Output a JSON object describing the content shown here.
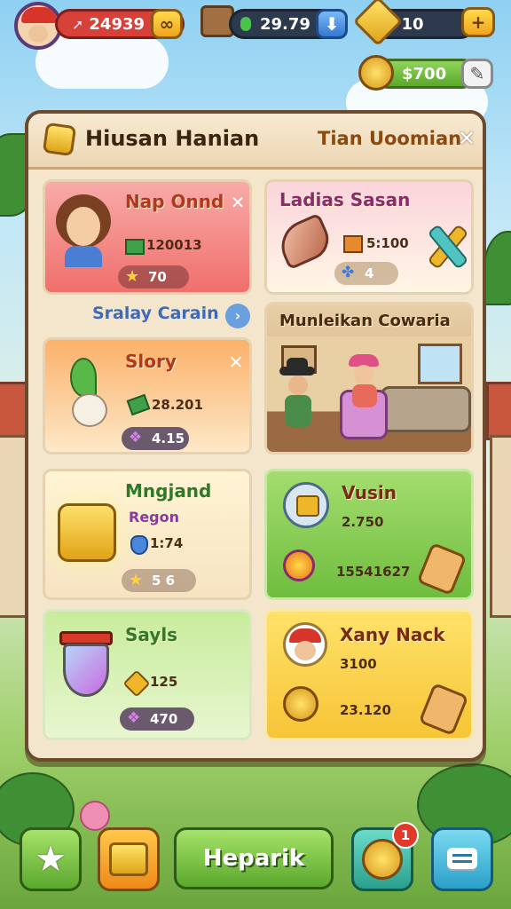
{
  "topbar": {
    "level_value": "24939",
    "cash_value": "29.79",
    "gem_value": "10",
    "coin_value": "$700"
  },
  "panel": {
    "title": "Hiusan Hanian",
    "subtitle": "Tian Uoomian"
  },
  "cards": {
    "c1": {
      "title": "Nap Onnd",
      "stat1": "120013",
      "badge": "70"
    },
    "c2": {
      "title": "Ladias Sasan",
      "stat1": "5:100",
      "badge": "4"
    },
    "section_link": "Sralay Carain",
    "c3": {
      "title": "Slory",
      "stat1": "28.201",
      "badge": "4.15"
    },
    "c4": {
      "title": "Munleikan Cowaria"
    },
    "c5": {
      "title": "Mngjand",
      "sub": "Regon",
      "stat1": "1:74",
      "badge": "5 6"
    },
    "c6": {
      "title": "Vusin",
      "stat1": "2.750",
      "stat2": "15541627"
    },
    "c7": {
      "title": "Sayls",
      "stat1": "125",
      "badge": "470"
    },
    "c8": {
      "title": "Xany Nack",
      "stat1": "3100",
      "stat2": "23.120"
    }
  },
  "bottombar": {
    "main_button": "Heparik",
    "notification_count": "1"
  },
  "colors": {
    "accent": "#7fc23f",
    "title_red": "#b1371f",
    "panel_bg": "#f4e6cc",
    "gold": "#f5c22f"
  }
}
